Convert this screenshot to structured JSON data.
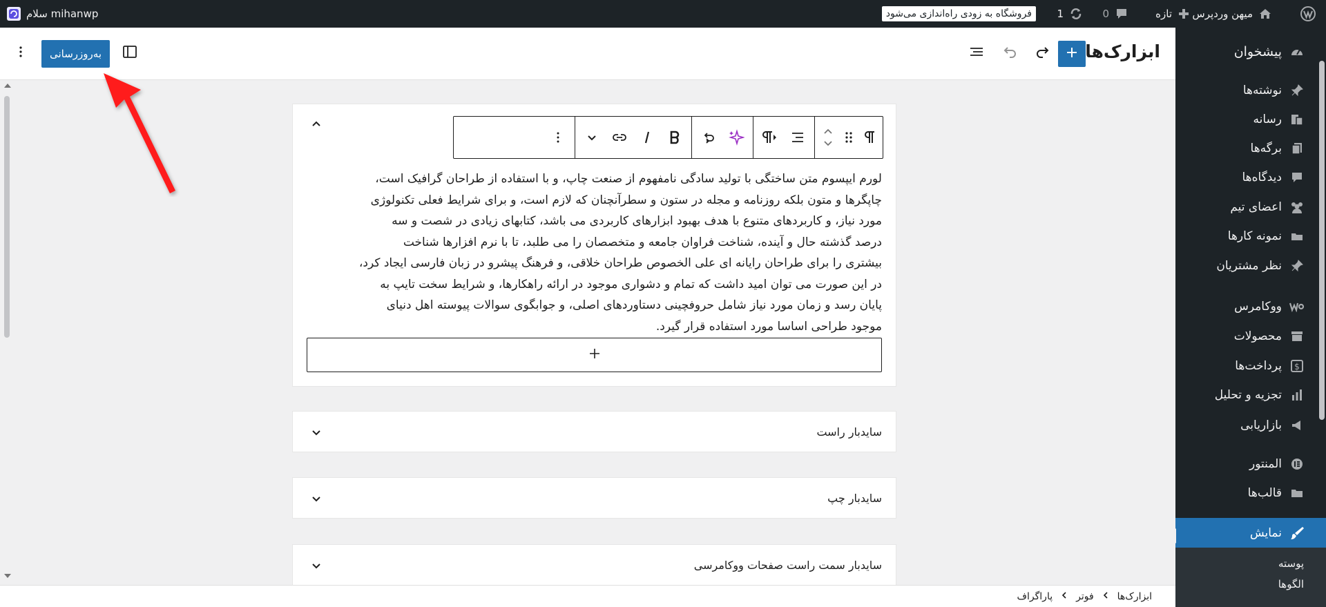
{
  "admin_bar": {
    "site_name": "میهن وردپرس",
    "notice": "فروشگاه به زودی راه‌اندازی می‌شود",
    "updates_count": "1",
    "comments_count": "0",
    "new_label": "تازه",
    "greeting": "سلام mihanwp"
  },
  "menu": {
    "items": [
      {
        "label": "پیشخوان",
        "icon": "dashboard-icon"
      },
      {
        "label": "نوشته‌ها",
        "icon": "pin-icon"
      },
      {
        "label": "رسانه",
        "icon": "media-icon"
      },
      {
        "label": "برگه‌ها",
        "icon": "pages-icon"
      },
      {
        "label": "دیدگاه‌ها",
        "icon": "comment-icon"
      },
      {
        "label": "اعضای تیم",
        "icon": "team-icon"
      },
      {
        "label": "نمونه کارها",
        "icon": "portfolio-icon"
      },
      {
        "label": "نظر مشتریان",
        "icon": "testimonial-icon"
      },
      {
        "label": "ووکامرس",
        "icon": "woocommerce-icon"
      },
      {
        "label": "محصولات",
        "icon": "archive-icon"
      },
      {
        "label": "پرداخت‌ها",
        "icon": "payment-icon"
      },
      {
        "label": "تجزیه و تحلیل",
        "icon": "chart-icon"
      },
      {
        "label": "بازاریابی",
        "icon": "megaphone-icon"
      },
      {
        "label": "المنتور",
        "icon": "elementor-icon"
      },
      {
        "label": "قالب‌ها",
        "icon": "folder-icon"
      },
      {
        "label": "نمایش",
        "icon": "brush-icon"
      }
    ],
    "submenu": [
      "پوسته",
      "الگوها"
    ]
  },
  "header": {
    "title": "ابزارک‌ها",
    "update_label": "به‌روزرسانی"
  },
  "editor": {
    "paragraph_lines": [
      "لورم ایپسوم متن ساختگی با تولید سادگی نامفهوم از صنعت چاپ، و با استفاده از طراحان گرافیک است،",
      "چاپگرها و متون بلکه روزنامه و مجله در ستون و سطرآنچنان که لازم است، و برای شرایط فعلی تکنولوژی",
      "مورد نیاز، و کاربردهای متنوع با هدف بهبود ابزارهای کاربردی می باشد، کتابهای زیادی در شصت و سه",
      "درصد گذشته حال و آینده، شناخت فراوان جامعه و متخصصان را می طلبد، تا با نرم افزارها شناخت",
      "بیشتری را برای طراحان رایانه ای علی الخصوص طراحان خلاقی، و فرهنگ پیشرو در زبان فارسی ایجاد کرد،",
      "در این صورت می توان امید داشت که تمام و دشواری موجود در ارائه راهکارها، و شرایط سخت تایپ به",
      "پایان رسد و زمان مورد نیاز شامل حروفچینی دستاوردهای اصلی، و جوابگوی سوالات پیوسته اهل دنیای",
      "موجود طراحی اساسا مورد استفاده قرار گیرد."
    ],
    "widget_areas": [
      "سایدبار راست",
      "سایدبار چپ",
      "سایدبار سمت راست صفحات ووکامرسی"
    ]
  },
  "breadcrumb": [
    "ابزارک‌ها",
    "فوتر",
    "پاراگراف"
  ],
  "colors": {
    "admin_dark": "#1d2327",
    "accent": "#2271b1",
    "pointer": "#ff1a1a"
  }
}
